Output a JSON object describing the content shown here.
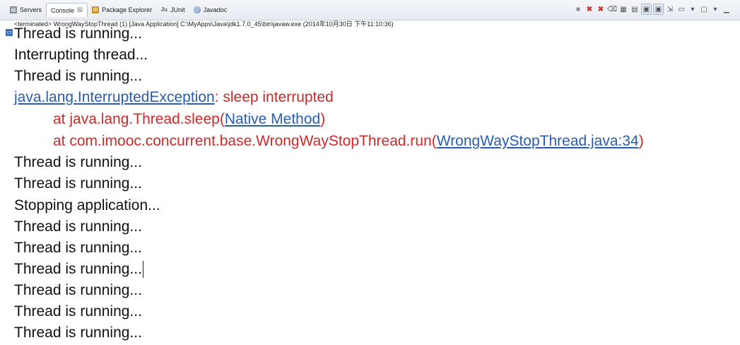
{
  "tabs": [
    {
      "label": "Servers",
      "icon": "servers-icon",
      "active": false
    },
    {
      "label": "Console",
      "icon": "console-icon",
      "active": true,
      "close": "☒"
    },
    {
      "label": "Package Explorer",
      "icon": "package-explorer-icon",
      "active": false
    },
    {
      "label": "JUnit",
      "icon": "junit-icon",
      "active": false
    },
    {
      "label": "Javadoc",
      "icon": "javadoc-icon",
      "active": false
    }
  ],
  "status": "<terminated> WrongWayStopThread (1) [Java Application] C:\\MyApps\\Java\\jdk1.7.0_45\\bin\\javaw.exe (2014年10月30日 下午11:10:36)",
  "console": {
    "lines": {
      "l0": "Thread is running...",
      "l1": "Interrupting thread...",
      "l2": "Thread is running...",
      "exc_link": "java.lang.InterruptedException",
      "exc_msg": ": sleep interrupted",
      "at1_prefix": "at java.lang.Thread.sleep(",
      "at1_link": "Native Method",
      "at1_suffix": ")",
      "at2_prefix": "at com.imooc.concurrent.base.WrongWayStopThread.run(",
      "at2_link": "WrongWayStopThread.java:34",
      "at2_suffix": ")",
      "l7": "Thread is running...",
      "l8": "Thread is running...",
      "l9": "Stopping application...",
      "l10": "Thread is running...",
      "l11": "Thread is running...",
      "l12": "Thread is running...",
      "l13": "Thread is running...",
      "l14": "Thread is running...",
      "l15": "Thread is running..."
    }
  },
  "colors": {
    "stdout": "#111111",
    "stderr": "#cc2a2a",
    "link": "#2a5db0"
  }
}
